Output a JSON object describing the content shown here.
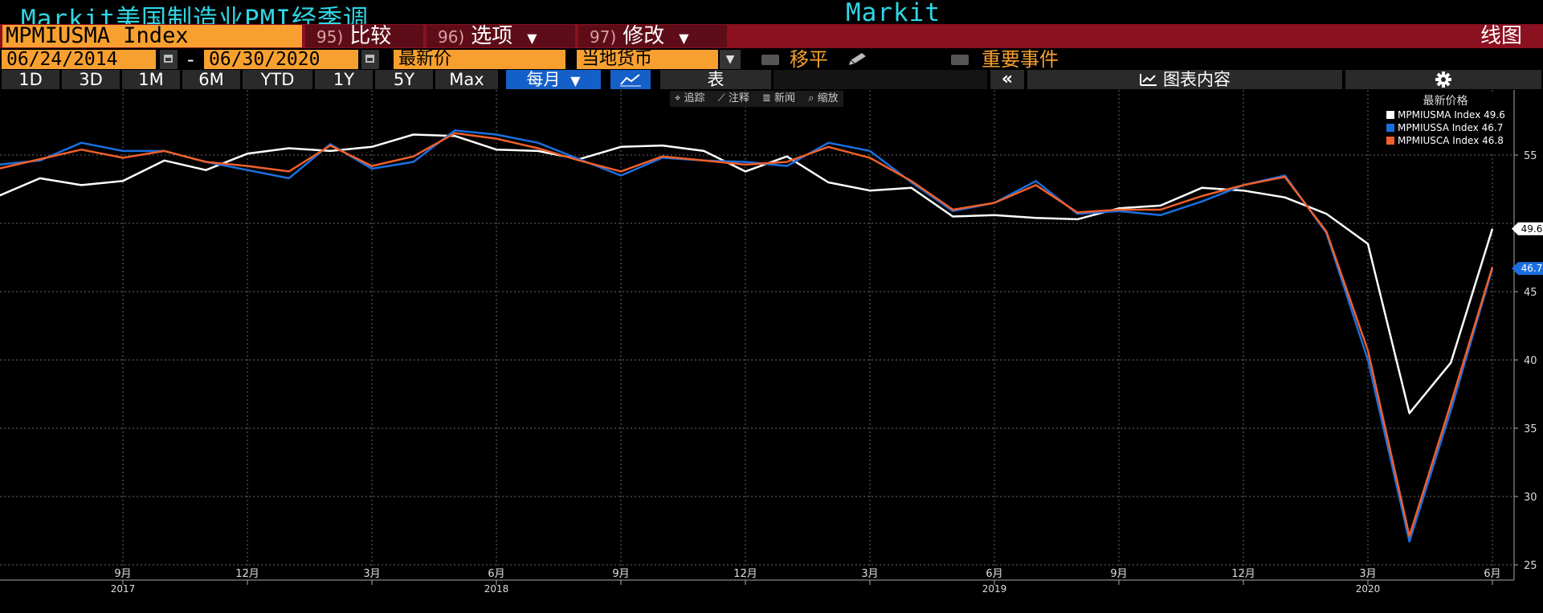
{
  "header": {
    "app_title": "Markit美国制造业PMI经季调",
    "source_title": "Markit"
  },
  "toolbar": {
    "ticker": "MPMIUSMA Index",
    "compare": {
      "num": "95)",
      "label": "比较"
    },
    "options": {
      "num": "96)",
      "label": "选项"
    },
    "edit": {
      "num": "97)",
      "label": "修改"
    },
    "chart_type": "线图"
  },
  "dates": {
    "start": "06/24/2014",
    "separator": "-",
    "end": "06/30/2020",
    "price_field": "最新价",
    "currency": "当地货币",
    "smooth_label": "移平",
    "events_label": "重要事件"
  },
  "ranges": [
    "1D",
    "3D",
    "1M",
    "6M",
    "YTD",
    "1Y",
    "5Y",
    "Max"
  ],
  "frequency": "每月",
  "view": {
    "table_label": "表",
    "collapse_icon": "«",
    "chart_content_label": "图表内容",
    "settings_icon": "gear-icon"
  },
  "mini_toolbar": [
    "追踪",
    "注释",
    "新闻",
    "缩放"
  ],
  "legend": {
    "title": "最新价格",
    "items": [
      {
        "name": "MPMIUSMA Index",
        "value": "49.6",
        "color": "#ffffff"
      },
      {
        "name": "MPMIUSSA Index",
        "value": "46.7",
        "color": "#1a6fe0"
      },
      {
        "name": "MPMIUSCA Index",
        "value": "46.8",
        "color": "#f0602a"
      }
    ]
  },
  "last_value_tags": [
    {
      "value": "49.6",
      "bg": "#ffffff",
      "fg": "#000000"
    },
    {
      "value": "46.7",
      "bg": "#1a6fe0",
      "fg": "#ffffff"
    }
  ],
  "chart_data": {
    "type": "line",
    "y_ticks": [
      25,
      30,
      35,
      40,
      45,
      55
    ],
    "ylim": [
      24,
      58
    ],
    "x_month_labels": [
      "9月",
      "12月",
      "3月",
      "6月",
      "9月",
      "12月",
      "3月",
      "6月",
      "9月",
      "12月",
      "3月",
      "6月",
      "9月",
      "12月",
      "3月",
      "6月"
    ],
    "x_year_labels": [
      "2017",
      "2018",
      "2019",
      "2020"
    ],
    "x": [
      "2017-06",
      "2017-07",
      "2017-08",
      "2017-09",
      "2017-10",
      "2017-11",
      "2017-12",
      "2018-01",
      "2018-02",
      "2018-03",
      "2018-04",
      "2018-05",
      "2018-06",
      "2018-07",
      "2018-08",
      "2018-09",
      "2018-10",
      "2018-11",
      "2018-12",
      "2019-01",
      "2019-02",
      "2019-03",
      "2019-04",
      "2019-05",
      "2019-06",
      "2019-07",
      "2019-08",
      "2019-09",
      "2019-10",
      "2019-11",
      "2019-12",
      "2020-01",
      "2020-02",
      "2020-03",
      "2020-04",
      "2020-05",
      "2020-06"
    ],
    "series": [
      {
        "name": "MPMIUSMA Index",
        "color": "#ffffff",
        "values": [
          52.0,
          53.3,
          52.8,
          53.1,
          54.6,
          53.9,
          55.1,
          55.5,
          55.3,
          55.6,
          56.5,
          56.4,
          55.4,
          55.3,
          54.7,
          55.6,
          55.7,
          55.3,
          53.8,
          54.9,
          53.0,
          52.4,
          52.6,
          50.5,
          50.6,
          50.4,
          50.3,
          51.1,
          51.3,
          52.6,
          52.4,
          51.9,
          50.7,
          48.5,
          36.1,
          39.8,
          49.6
        ]
      },
      {
        "name": "MPMIUSSA Index",
        "color": "#1a6fe0",
        "values": [
          54.3,
          54.6,
          55.9,
          55.3,
          55.3,
          54.5,
          53.9,
          53.3,
          55.8,
          54.0,
          54.5,
          56.8,
          56.5,
          55.9,
          54.7,
          53.5,
          54.8,
          54.6,
          54.5,
          54.2,
          55.9,
          55.3,
          53.0,
          50.9,
          51.5,
          53.1,
          50.7,
          50.9,
          50.6,
          51.6,
          52.8,
          53.5,
          49.3,
          40.0,
          26.7,
          36.3,
          46.7
        ]
      },
      {
        "name": "MPMIUSCA Index",
        "color": "#f0602a",
        "values": [
          54.0,
          54.7,
          55.4,
          54.8,
          55.3,
          54.5,
          54.2,
          53.8,
          55.7,
          54.2,
          54.9,
          56.6,
          56.2,
          55.5,
          54.6,
          53.8,
          54.9,
          54.6,
          54.3,
          54.5,
          55.6,
          54.8,
          53.1,
          51.0,
          51.5,
          52.8,
          50.8,
          51.0,
          51.0,
          52.0,
          52.8,
          53.4,
          49.4,
          40.7,
          27.1,
          36.8,
          46.8
        ]
      }
    ]
  }
}
